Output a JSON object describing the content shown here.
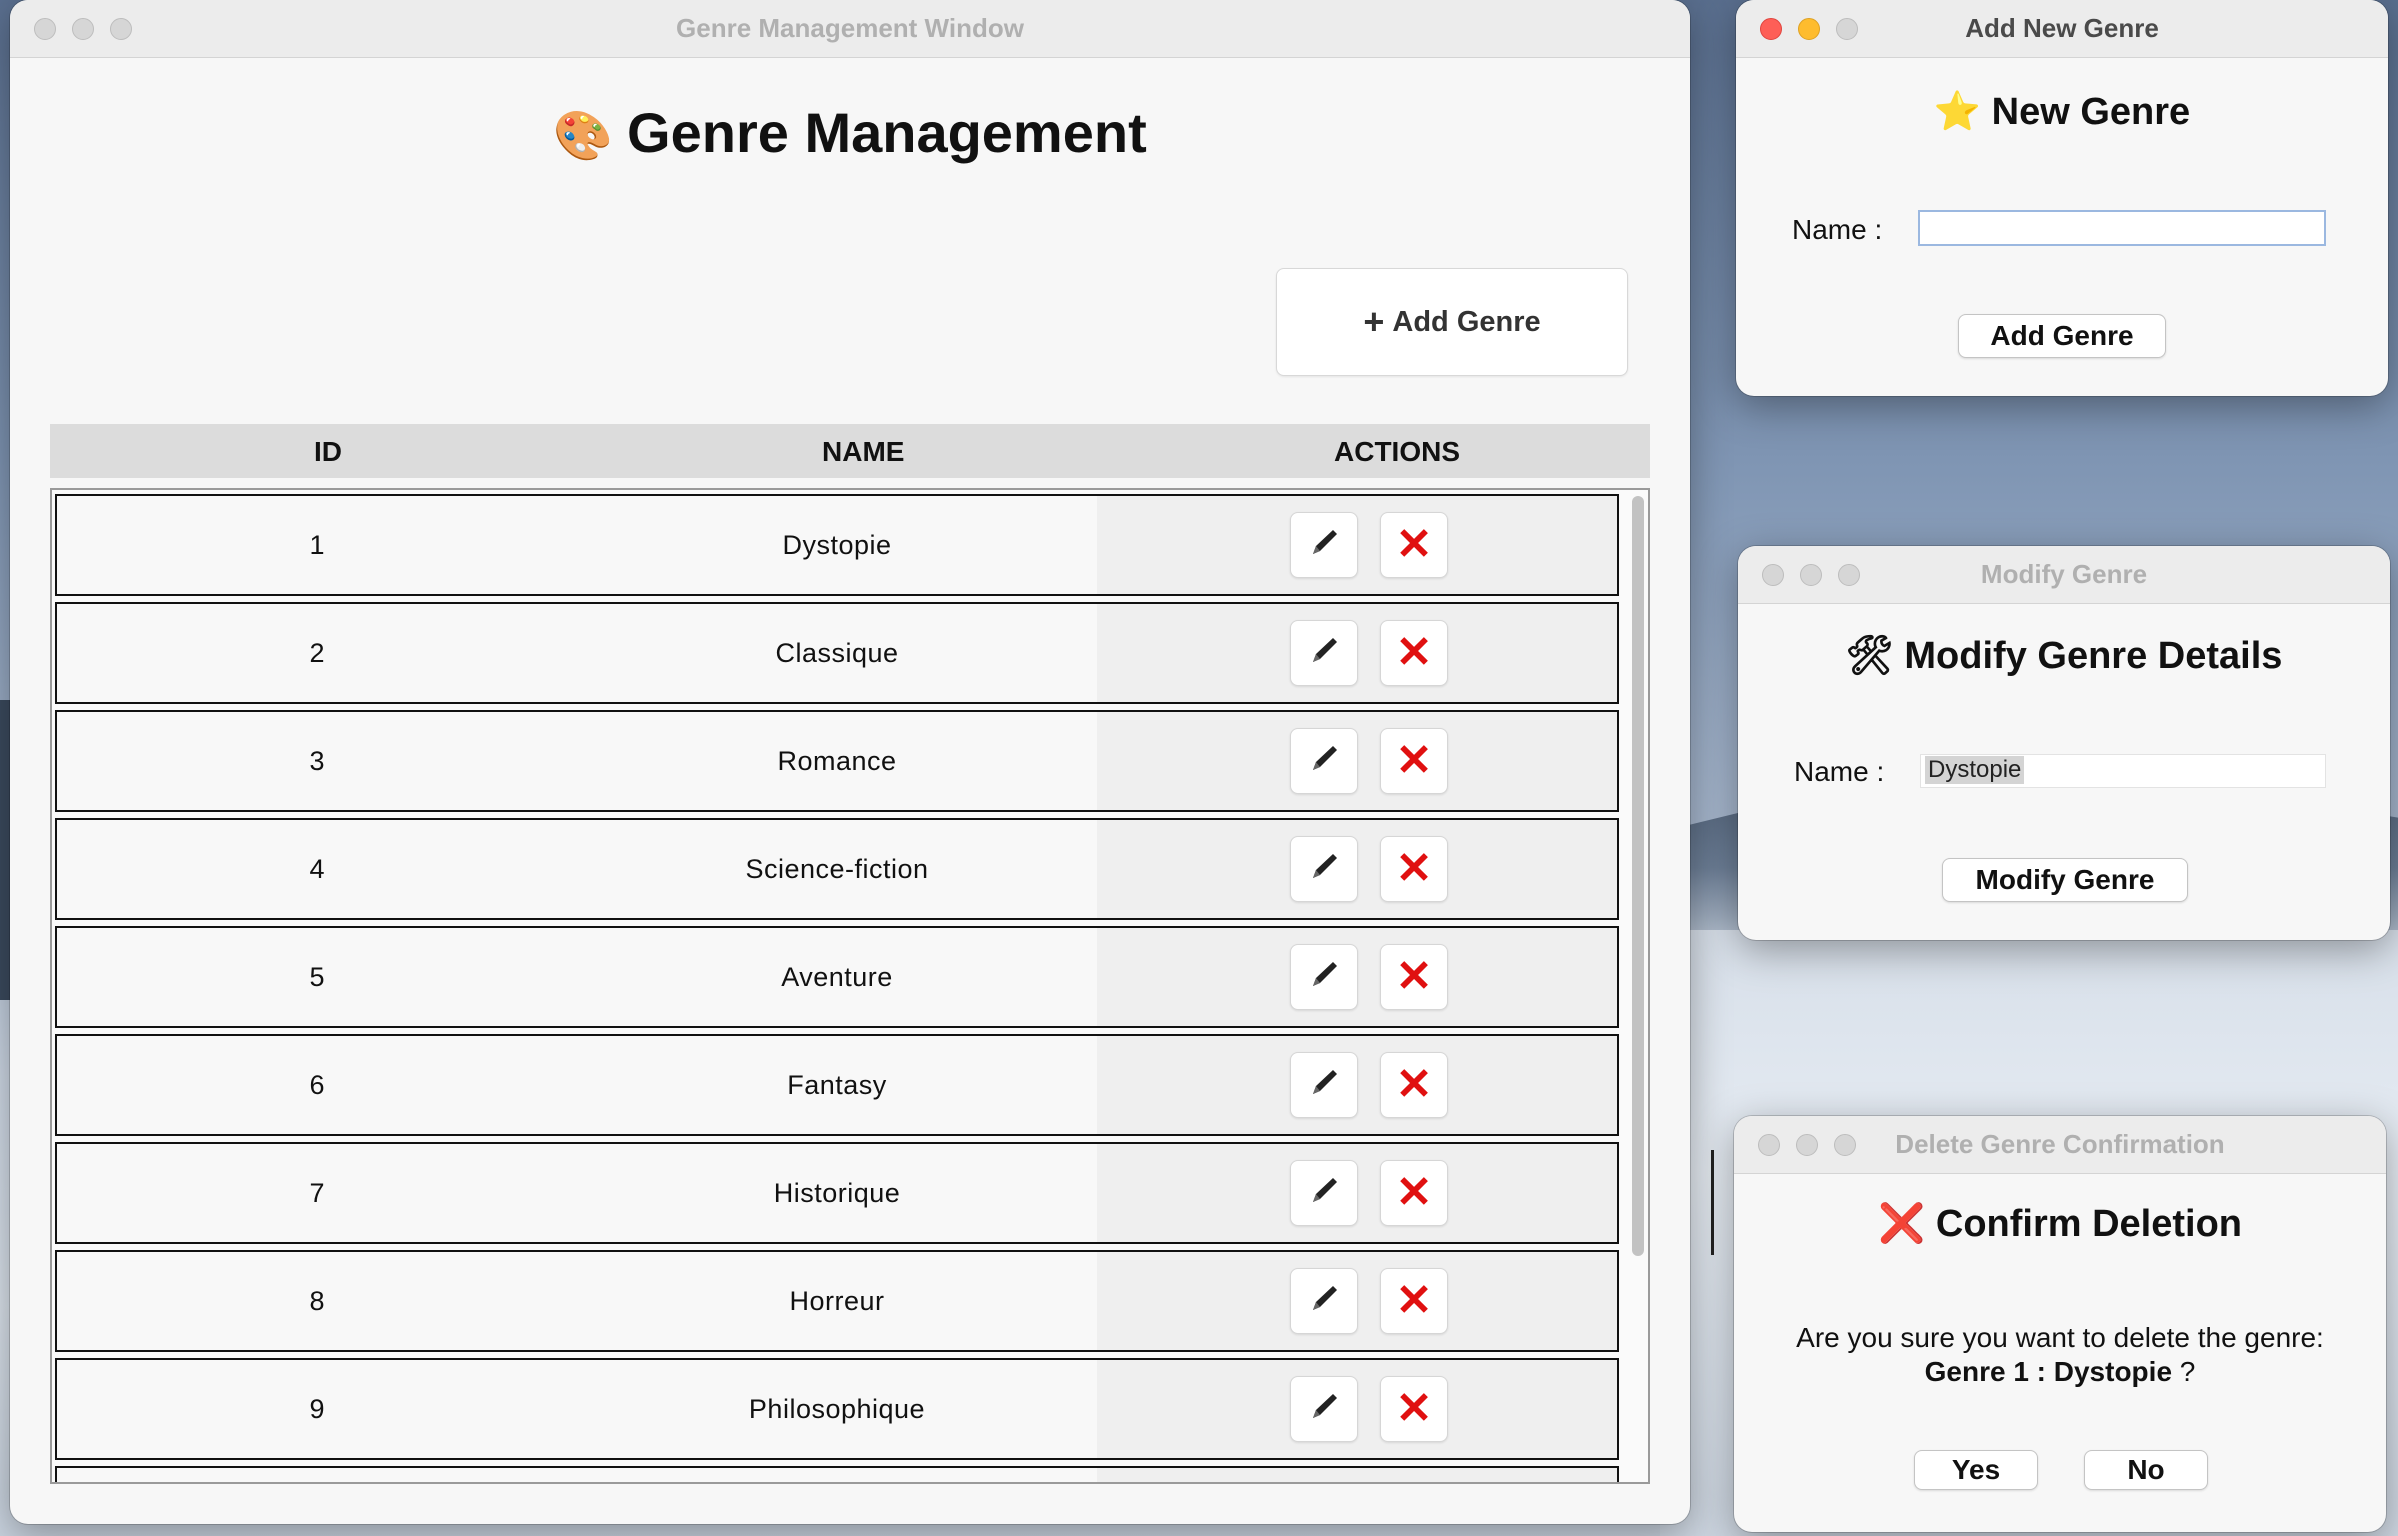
{
  "main_window": {
    "title": "Genre Management Window",
    "heading_emoji": "🎨",
    "heading": "Genre Management",
    "add_button_icon": "+",
    "add_button_label": "Add Genre",
    "columns": [
      "ID",
      "NAME",
      "ACTIONS"
    ],
    "rows": [
      {
        "id": "1",
        "name": "Dystopie"
      },
      {
        "id": "2",
        "name": "Classique"
      },
      {
        "id": "3",
        "name": "Romance"
      },
      {
        "id": "4",
        "name": "Science-fiction"
      },
      {
        "id": "5",
        "name": "Aventure"
      },
      {
        "id": "6",
        "name": "Fantasy"
      },
      {
        "id": "7",
        "name": "Historique"
      },
      {
        "id": "8",
        "name": "Horreur"
      },
      {
        "id": "9",
        "name": "Philosophique"
      }
    ],
    "edit_icon": "pencil-icon",
    "delete_icon": "red-x-icon",
    "delete_glyph": "✕"
  },
  "add_window": {
    "title": "Add New Genre",
    "heading_emoji": "⭐",
    "heading": "New Genre",
    "name_label": "Name :",
    "name_value": "",
    "button_label": "Add Genre"
  },
  "modify_window": {
    "title": "Modify Genre",
    "heading_emoji": "🛠",
    "heading": "Modify Genre Details",
    "name_label": "Name :",
    "name_value": "Dystopie",
    "button_label": "Modify Genre"
  },
  "delete_window": {
    "title": "Delete Genre Confirmation",
    "heading_icon": "❌",
    "heading": "Confirm Deletion",
    "message": "Are you sure you want to delete the genre:",
    "genre_ref": "Genre 1 : Dystopie",
    "question_mark": "?",
    "yes_label": "Yes",
    "no_label": "No"
  },
  "colors": {
    "delete_red": "#e01010",
    "close_red": "#fe5f57",
    "minimize_yellow": "#febc2e"
  }
}
